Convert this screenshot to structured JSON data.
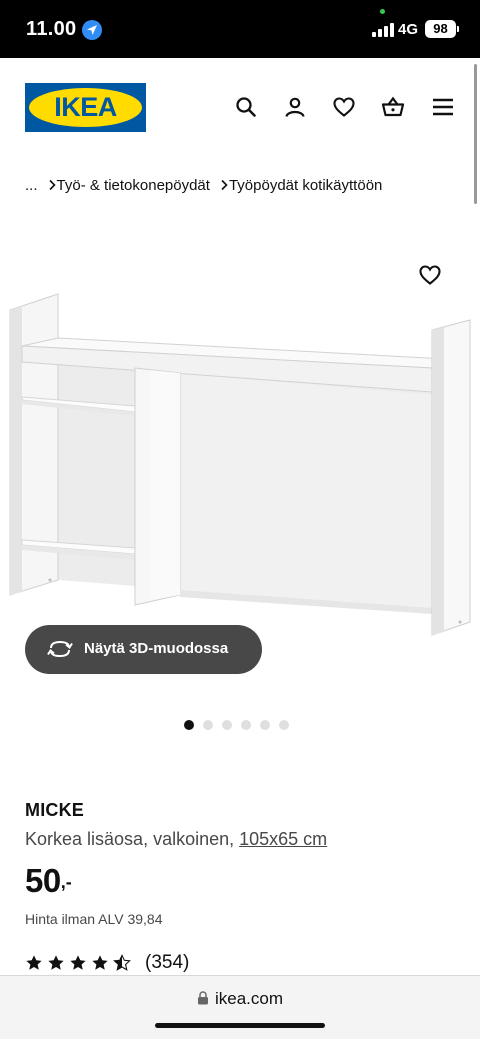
{
  "status_bar": {
    "time": "11.00",
    "network": "4G",
    "battery": "98"
  },
  "header": {
    "logo_text": "IKEA",
    "icons": [
      "search-icon",
      "user-icon",
      "heart-icon",
      "basket-icon",
      "menu-icon"
    ]
  },
  "breadcrumb": {
    "items": [
      "...",
      "Työ- & tietokonepöydät",
      "Työpöydät kotikäyttöön"
    ]
  },
  "gallery": {
    "view_3d_label": "Näytä 3D-muodossa",
    "dot_count": 6,
    "active_dot": 1
  },
  "product": {
    "name": "MICKE",
    "description": "Korkea lisäosa, valkoinen, ",
    "dimensions": "105x65 cm",
    "price_integer": "50",
    "price_decimal": ",-",
    "vat_text": "Hinta ilman ALV 39,84",
    "rating": 4.5,
    "rating_count": "(354)"
  },
  "browser": {
    "url": "ikea.com"
  },
  "colors": {
    "ikea_blue": "#0058a3",
    "ikea_yellow": "#ffdb00",
    "button_dark": "#484848"
  }
}
